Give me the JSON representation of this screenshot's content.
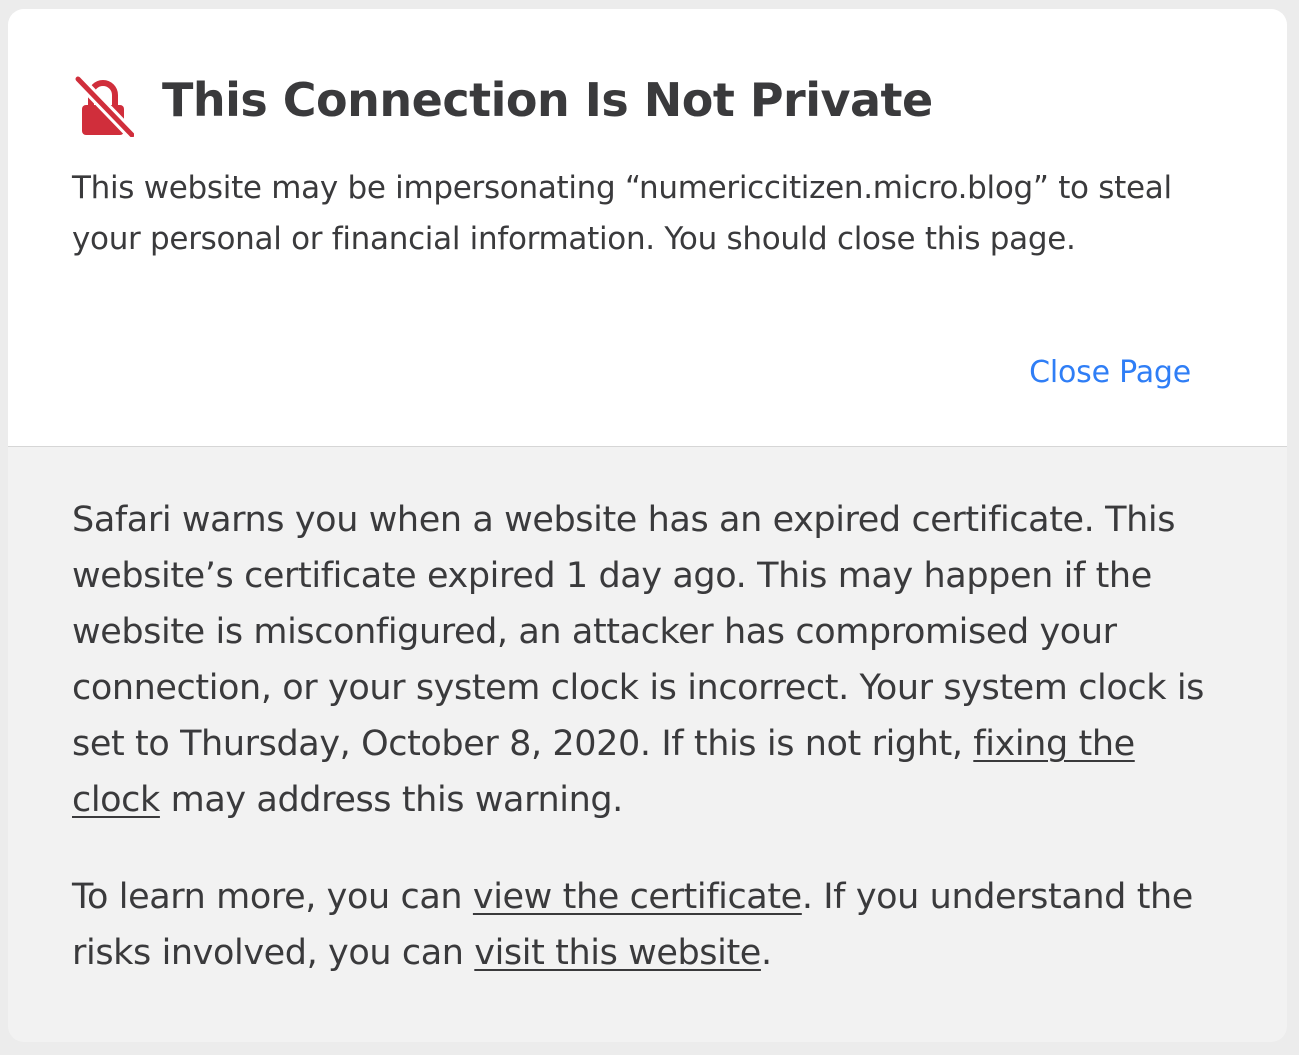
{
  "colors": {
    "warning_icon": "#d02e3b",
    "title_text": "#3a3a3c",
    "link_blue": "#2f7ef6",
    "header_background": "#ffffff",
    "details_background": "#f2f2f2"
  },
  "header": {
    "icon": "lock-slash-icon",
    "title": "This Connection Is Not Private",
    "summary": "This website may be impersonating “numericcitizen.micro.blog” to steal your personal or financial information. You should close this page.",
    "close_button": "Close Page"
  },
  "details": {
    "p1_text": "Safari warns you when a website has an expired certificate. This website’s certificate expired 1 day ago. This may happen if the website is misconfigured, an attacker has compromised your connection, or your system clock is incorrect. Your system clock is set to Thursday, October 8, 2020. If this is not right, ",
    "p1_link": "fixing the clock",
    "p1_tail": " may address this warning.",
    "p2_text": "To learn more, you can ",
    "p2_link1": "view the certificate",
    "p2_mid": ". If you understand the risks involved, you can ",
    "p2_link2": "visit this website",
    "p2_tail": "."
  }
}
